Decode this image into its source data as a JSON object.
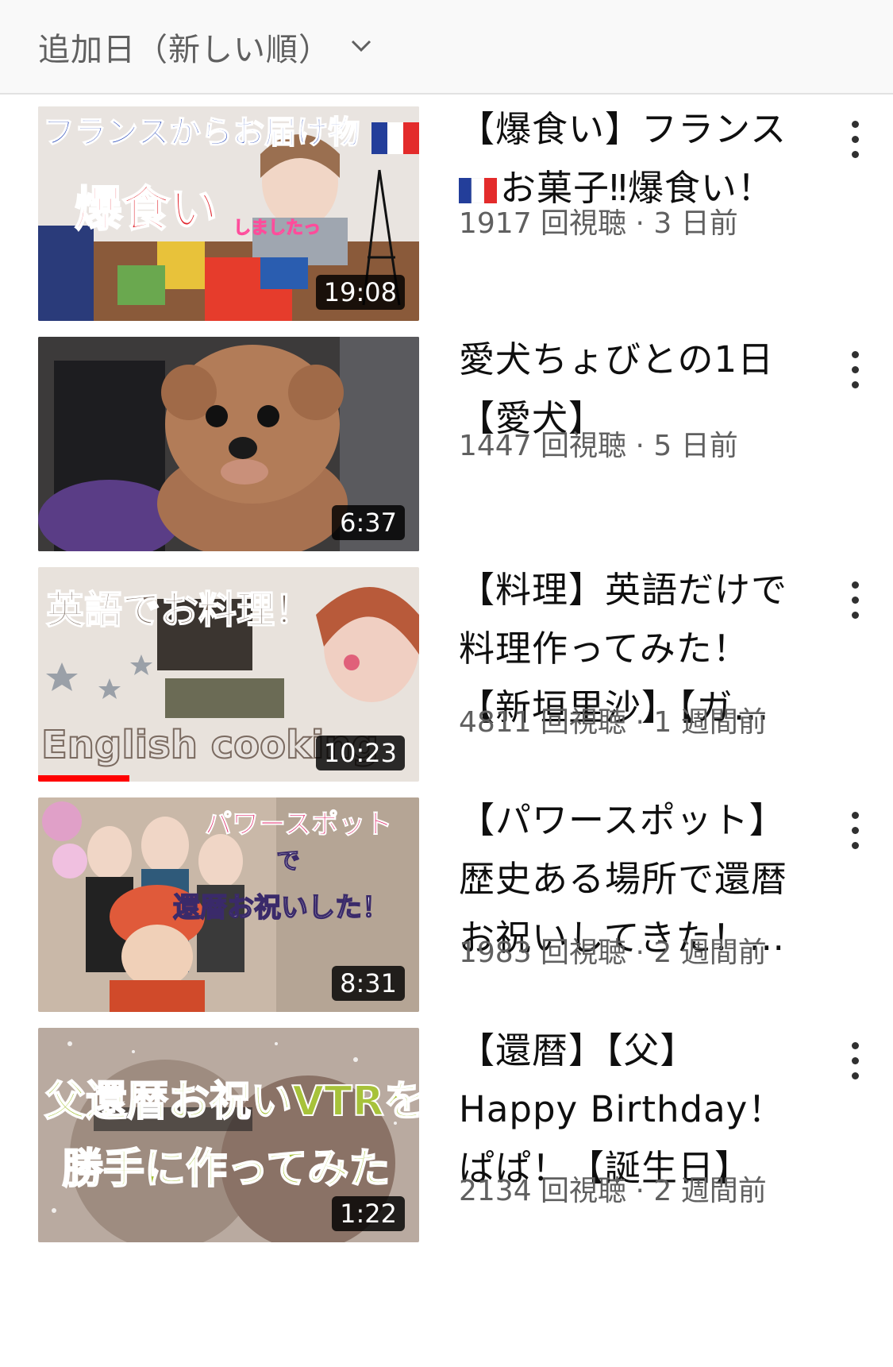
{
  "sort": {
    "label": "追加日（新しい順）",
    "chevron_icon": "chevron-down-icon"
  },
  "videos": [
    {
      "title": "【爆食い】フランス🇫🇷お菓子‼爆食い！",
      "title_pre": "【爆食い】フランス",
      "title_post": "お菓子‼爆食い！",
      "views": "1917 回視聴",
      "age": "3 日前",
      "duration": "19:08",
      "thumb_text": [
        "フランスからお届け物",
        "爆食い",
        "しましたっ"
      ],
      "progress": 0
    },
    {
      "title": "愛犬ちょびとの1日【愛犬】",
      "views": "1447 回視聴",
      "age": "5 日前",
      "duration": "6:37",
      "thumb_text": [],
      "progress": 0
    },
    {
      "title": "【料理】英語だけで料理作ってみた！【新垣里沙】【ガ…",
      "views": "4811 回視聴",
      "age": "1 週間前",
      "duration": "10:23",
      "thumb_text": [
        "英語でお料理！",
        "English cooking"
      ],
      "progress": 0.24
    },
    {
      "title": "【パワースポット】歴史ある場所で還暦お祝いしてきた！…",
      "views": "1983 回視聴",
      "age": "2 週間前",
      "duration": "8:31",
      "thumb_text": [
        "パワースポット",
        "で",
        "還暦お祝いした！"
      ],
      "progress": 0
    },
    {
      "title": "【還暦】【父】Happy Birthday！ぱぱ！【誕生日】",
      "views": "2134 回視聴",
      "age": "2 週間前",
      "duration": "1:22",
      "thumb_text": [
        "父還暦お祝いVTRを",
        "勝手に作ってみた"
      ],
      "progress": 0
    }
  ],
  "colors": {
    "accent_red": "#ff0000",
    "meta_gray": "#606060",
    "title": "#0f0f0f"
  },
  "icons": {
    "menu": "more-vert-icon",
    "flag": "france-flag-icon"
  }
}
